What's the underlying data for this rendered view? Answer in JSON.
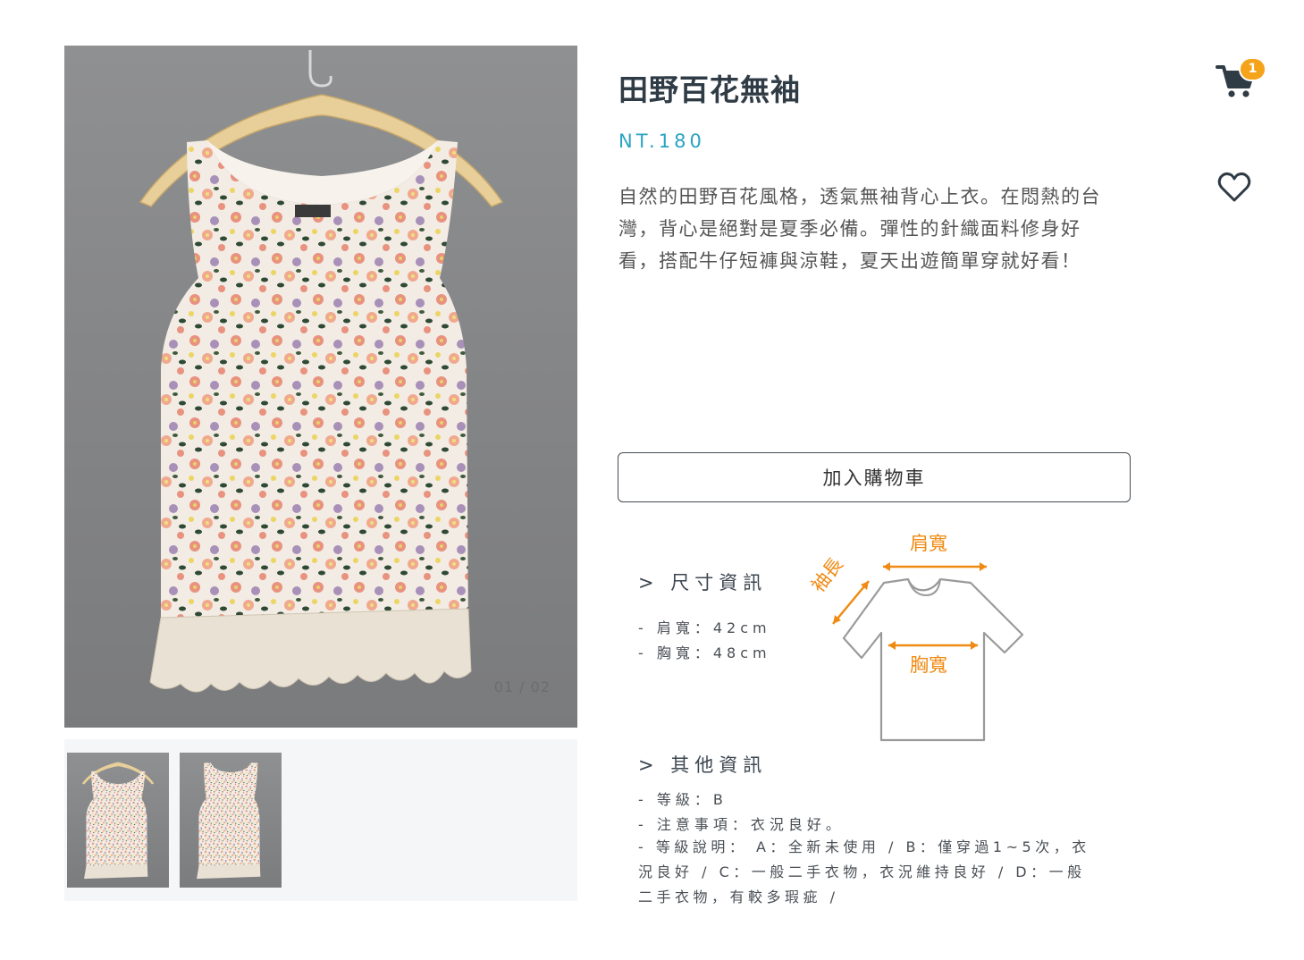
{
  "product": {
    "title": "田野百花無袖",
    "price": "NT.180",
    "description": "自然的田野百花風格，透氣無袖背心上衣。在悶熱的台灣，背心是絕對是夏季必備。彈性的針織面料修身好看，搭配牛仔短褲與涼鞋，夏天出遊簡單穿就好看！"
  },
  "gallery": {
    "counter": "01 / 02",
    "thumbnails": [
      "front-view",
      "back-view"
    ]
  },
  "cart": {
    "badge_count": "1",
    "icon": "cart-icon"
  },
  "wishlist": {
    "icon": "heart-icon"
  },
  "actions": {
    "add_to_cart": "加入購物車"
  },
  "size_info": {
    "heading": "> 尺寸資訊",
    "shoulder": "- 肩寬：42cm",
    "chest": "- 胸寬：48cm"
  },
  "diagram": {
    "shoulder_label": "肩寬",
    "sleeve_label": "袖長",
    "chest_label": "胸寬"
  },
  "other_info": {
    "heading": "> 其他資訊",
    "grade": "- 等級：B",
    "note": "- 注意事項：衣況良好。",
    "grade_description": "- 等級說明： A：全新未使用 / B：僅穿過1~5次，衣況良好 / C：一般二手衣物，衣況維持良好 / D：一般二手衣物，有較多瑕疵 /"
  },
  "colors": {
    "price": "#2aa3c2",
    "badge": "#f5a31a",
    "diagram_accent": "#f08a12",
    "title": "#2f3b45"
  }
}
